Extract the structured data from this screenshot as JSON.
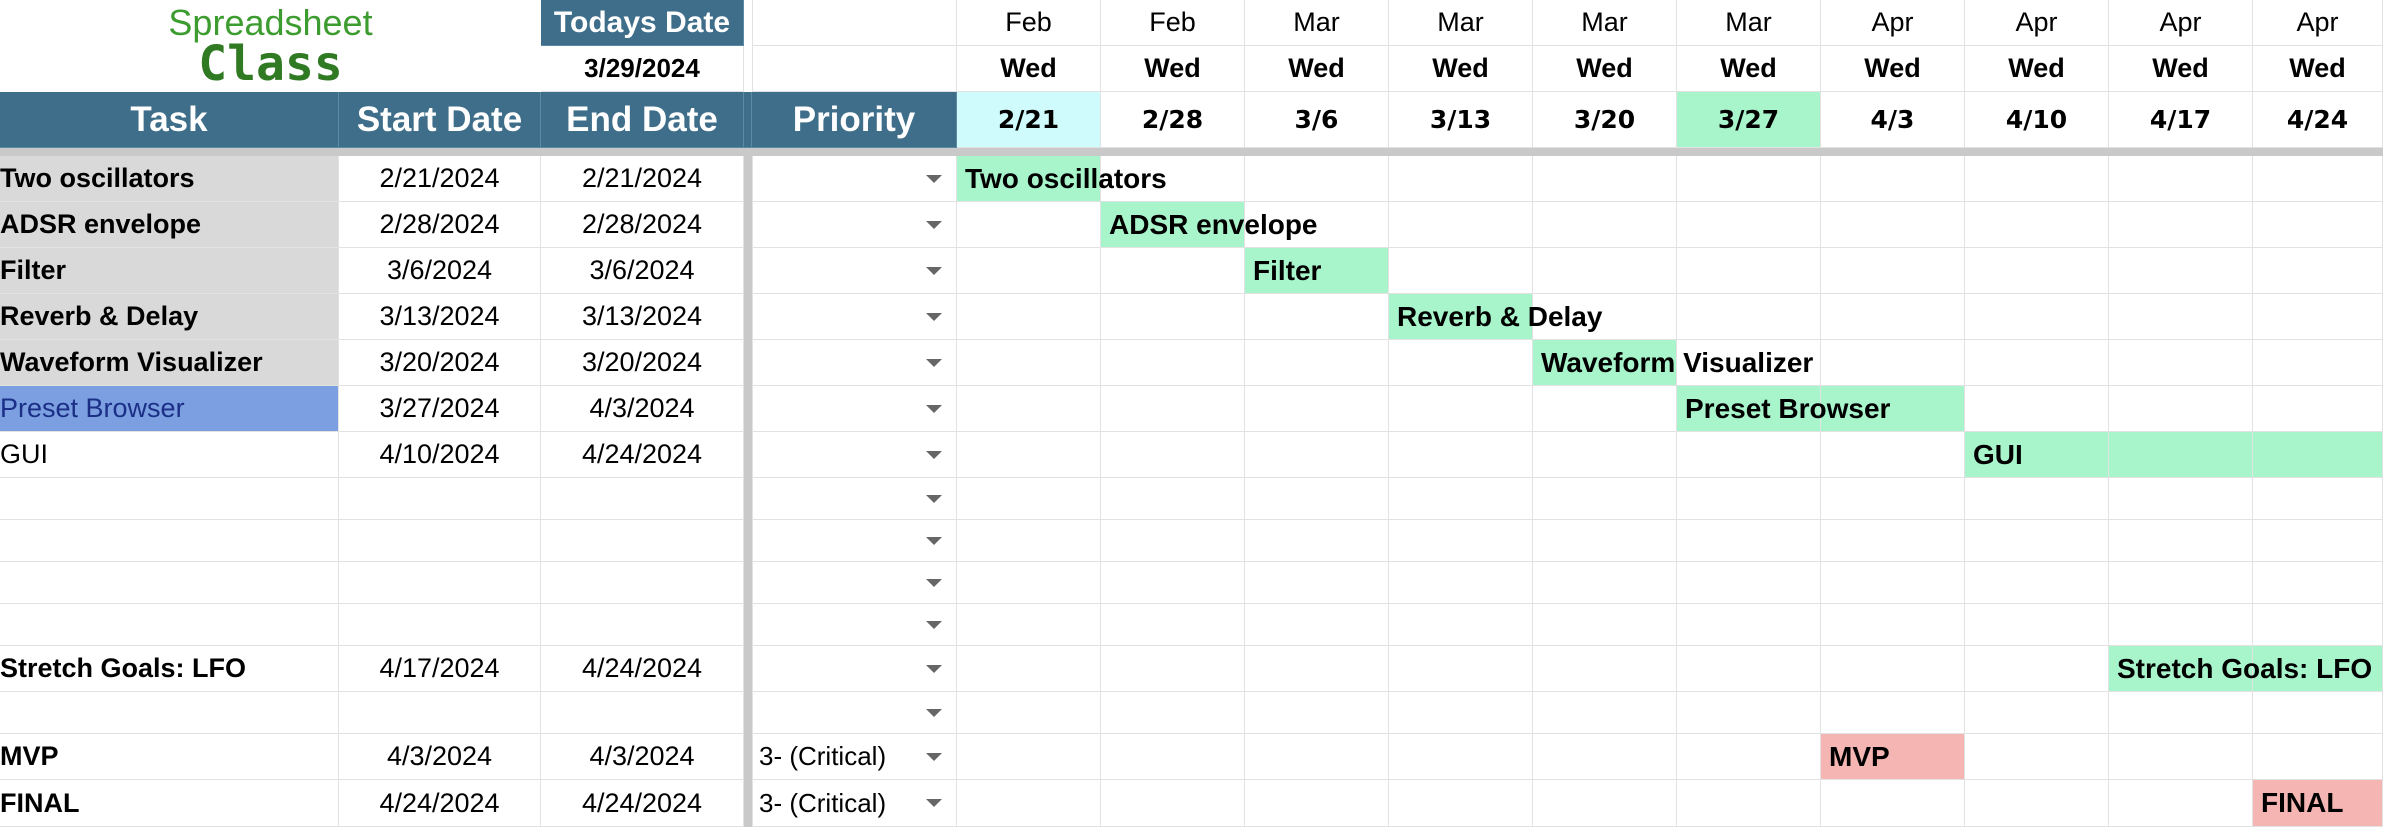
{
  "logo": {
    "line1": "Spreadsheet",
    "line2": "Class"
  },
  "today": {
    "label": "Todays Date",
    "value": "3/29/2024"
  },
  "headers": {
    "task": "Task",
    "start": "Start Date",
    "end": "End Date",
    "priority": "Priority"
  },
  "weeks": [
    {
      "month": "Feb",
      "day": "Wed",
      "date": "2/21"
    },
    {
      "month": "Feb",
      "day": "Wed",
      "date": "2/28"
    },
    {
      "month": "Mar",
      "day": "Wed",
      "date": "3/6"
    },
    {
      "month": "Mar",
      "day": "Wed",
      "date": "3/13"
    },
    {
      "month": "Mar",
      "day": "Wed",
      "date": "3/20"
    },
    {
      "month": "Mar",
      "day": "Wed",
      "date": "3/27"
    },
    {
      "month": "Apr",
      "day": "Wed",
      "date": "4/3"
    },
    {
      "month": "Apr",
      "day": "Wed",
      "date": "4/10"
    },
    {
      "month": "Apr",
      "day": "Wed",
      "date": "4/17"
    },
    {
      "month": "Apr",
      "day": "Wed",
      "date": "4/24"
    }
  ],
  "tasks": [
    {
      "name": "Two oscillators",
      "start": "2/21/2024",
      "end": "2/21/2024",
      "priority": ""
    },
    {
      "name": "ADSR envelope",
      "start": "2/28/2024",
      "end": "2/28/2024",
      "priority": ""
    },
    {
      "name": "Filter",
      "start": "3/6/2024",
      "end": "3/6/2024",
      "priority": ""
    },
    {
      "name": "Reverb & Delay",
      "start": "3/13/2024",
      "end": "3/13/2024",
      "priority": ""
    },
    {
      "name": "Waveform Visualizer",
      "start": "3/20/2024",
      "end": "3/20/2024",
      "priority": ""
    },
    {
      "name": "Preset Browser",
      "start": "3/27/2024",
      "end": "4/3/2024",
      "priority": ""
    },
    {
      "name": "GUI",
      "start": "4/10/2024",
      "end": "4/24/2024",
      "priority": ""
    },
    {
      "name": "",
      "start": "",
      "end": "",
      "priority": ""
    },
    {
      "name": "",
      "start": "",
      "end": "",
      "priority": ""
    },
    {
      "name": "",
      "start": "",
      "end": "",
      "priority": ""
    },
    {
      "name": "",
      "start": "",
      "end": "",
      "priority": ""
    },
    {
      "name": "Stretch Goals: LFO",
      "start": "4/17/2024",
      "end": "4/24/2024",
      "priority": ""
    },
    {
      "name": "",
      "start": "",
      "end": "",
      "priority": ""
    },
    {
      "name": "MVP",
      "start": "4/3/2024",
      "end": "4/3/2024",
      "priority": "3- (Critical)"
    },
    {
      "name": "FINAL",
      "start": "4/24/2024",
      "end": "4/24/2024",
      "priority": "3- (Critical)"
    }
  ],
  "colors": {
    "header": "#3f6e8a",
    "bar": "#a8f5cc",
    "milestone": "#f4b5b3",
    "currentWeek": "#a8f5cc",
    "firstWeek": "#cffbfc"
  }
}
